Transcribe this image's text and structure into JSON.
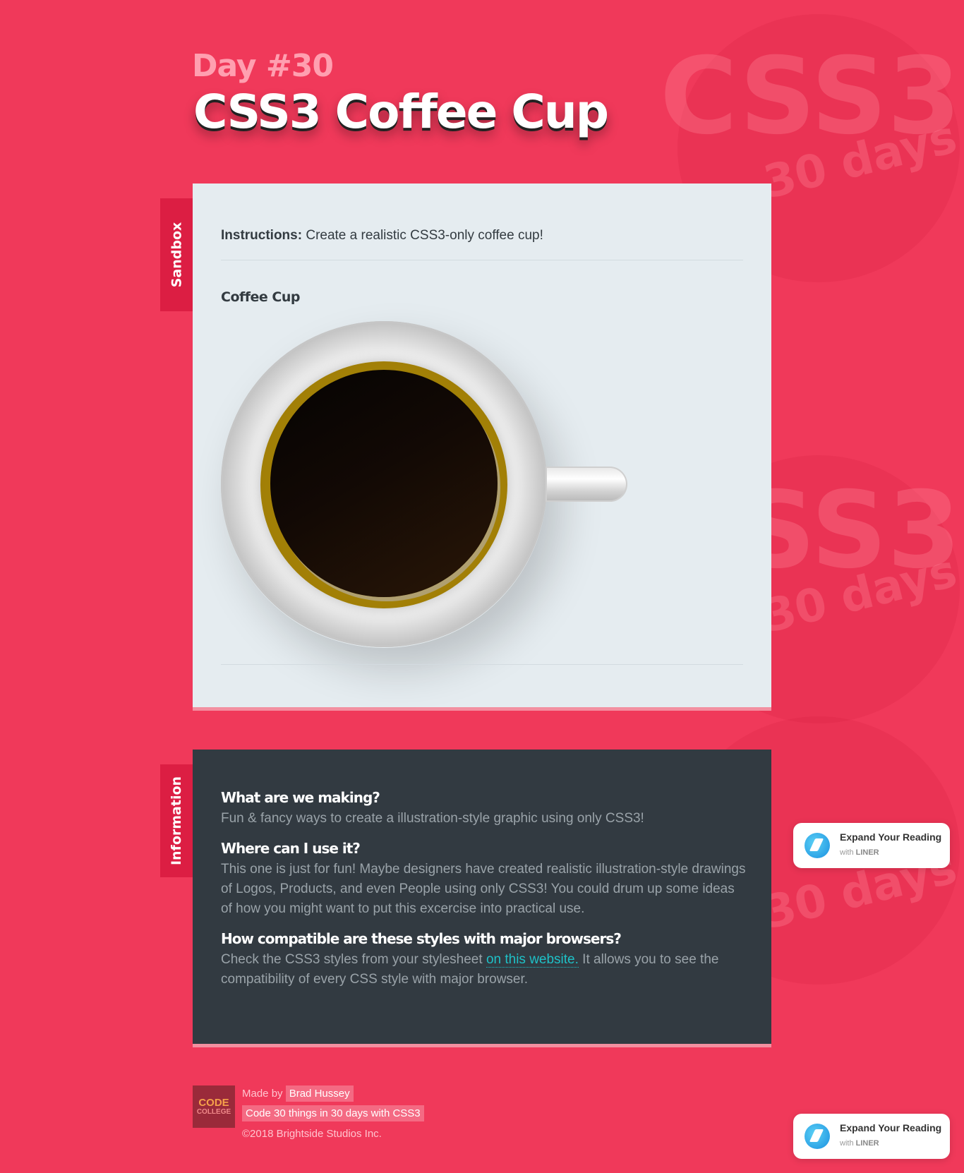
{
  "header": {
    "day": "Day #30",
    "title": "CSS3 Coffee Cup"
  },
  "watermark": {
    "big_text": "CSS3",
    "script_text": "30 days"
  },
  "tabs": {
    "sandbox": "Sandbox",
    "information": "Information"
  },
  "sandbox": {
    "instructions_label": "Instructions:",
    "instructions_text": " Create a realistic CSS3-only coffee cup!",
    "section_title": "Coffee Cup"
  },
  "info": {
    "q1": "What are we making?",
    "a1": "Fun & fancy ways to create a illustration-style graphic using only CSS3!",
    "q2": "Where can I use it?",
    "a2": "This one is just for fun! Maybe designers have created realistic illustration-style drawings of Logos, Products, and even People using only CSS3! You could drum up some ideas of how you might want to put this excercise into practical use.",
    "q3": "How compatible are these styles with major browsers?",
    "a3_before": "Check the CSS3 styles from your stylesheet ",
    "a3_link": "on this website.",
    "a3_after": " It allows you to see the compatibility of every CSS style with major browser."
  },
  "liner": {
    "title": "Expand Your Reading",
    "subtitle_prefix": "with ",
    "subtitle_brand": "LINER"
  },
  "footer": {
    "logo_line1": "CODE",
    "logo_line2": "COLLEGE",
    "made_by_label": "Made by",
    "author": "Brad Hussey",
    "course": "Code 30 things in 30 days with CSS3",
    "copyright": "©2018 Brightside Studios Inc."
  }
}
